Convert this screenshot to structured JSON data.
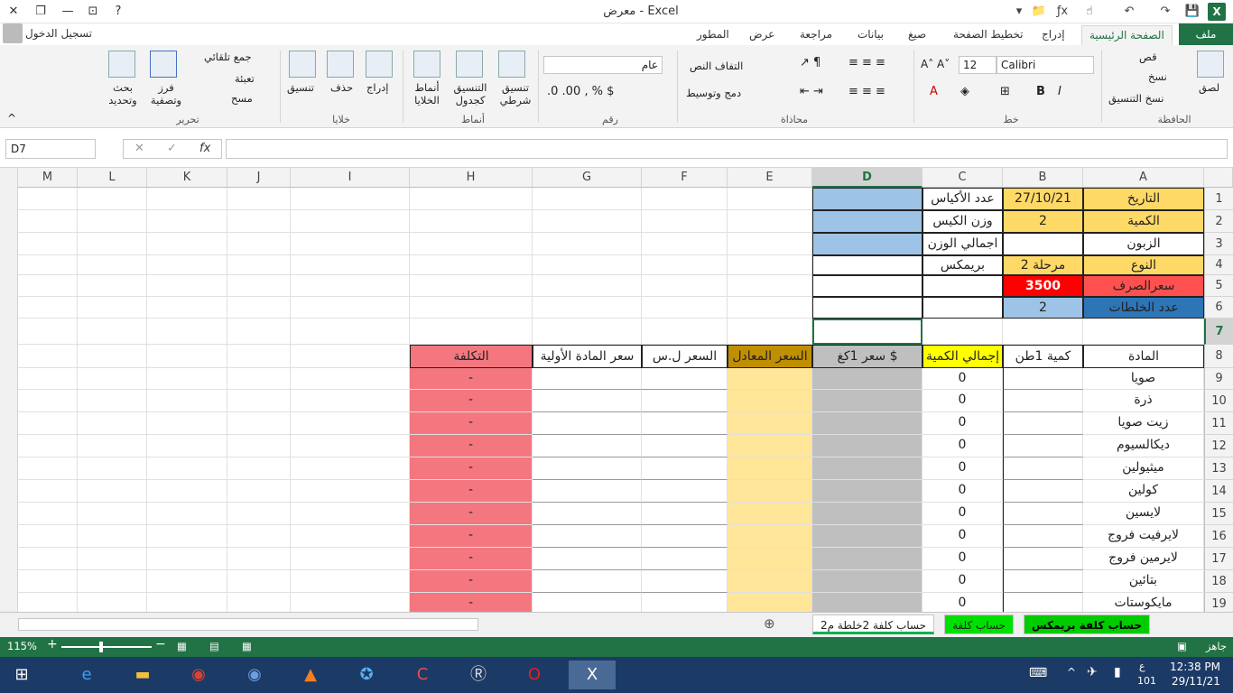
{
  "title": "معرض - Excel",
  "signin": "تسجيل الدخول",
  "tabs": {
    "file": "ملف",
    "home": "الصفحة الرئيسية",
    "insert": "إدراج",
    "page_layout": "تخطيط الصفحة",
    "formulas": "صيغ",
    "data": "بيانات",
    "review": "مراجعة",
    "view": "عرض",
    "developer": "المطور"
  },
  "ribbon": {
    "clipboard": {
      "label": "الحافظة",
      "paste": "لصق",
      "cut": "قص",
      "copy": "نسخ",
      "format_painter": "نسخ التنسيق"
    },
    "font": {
      "label": "خط",
      "name": "Calibri",
      "size": "12"
    },
    "alignment": {
      "label": "محاذاة",
      "wrap": "التفاف النص",
      "merge": "دمج وتوسيط"
    },
    "number": {
      "label": "رقم",
      "format": "عام"
    },
    "styles": {
      "label": "أنماط",
      "conditional": "تنسيق شرطي",
      "as_table": "التنسيق كجدول",
      "cell_styles": "أنماط الخلايا"
    },
    "cells": {
      "label": "خلايا",
      "insert": "إدراج",
      "delete": "حذف",
      "format": "تنسيق"
    },
    "editing": {
      "label": "تحرير",
      "autosum": "جمع تلقائي",
      "fill": "تعبئة",
      "clear": "مسح",
      "sort": "فرز وتصفية",
      "find": "بحث وتحديد"
    }
  },
  "namebox": "D7",
  "fx": "fx",
  "columns": [
    "A",
    "B",
    "C",
    "D",
    "E",
    "F",
    "G",
    "H",
    "I",
    "J",
    "K",
    "L",
    "M"
  ],
  "rows": [
    "1",
    "2",
    "3",
    "4",
    "5",
    "6",
    "7",
    "8",
    "9",
    "10",
    "11",
    "12",
    "13",
    "14",
    "15",
    "16",
    "17",
    "18",
    "19"
  ],
  "cells": {
    "A1": "التاريخ",
    "B1": "27/10/21",
    "C1": "عدد الأكياس",
    "A2": "الكمية",
    "B2": "2",
    "C2": "وزن الكيس",
    "A3": "الزبون",
    "C3": "اجمالي الوزن",
    "A4": "النوع",
    "B4": "مرحلة 2",
    "C4": "بريمكس",
    "A5": "سعرالصرف",
    "B5": "3500",
    "A6": "عدد الخلطات",
    "B6": "2",
    "A8": "المادة",
    "B8": "كمية 1طن",
    "C8": "إجمالي الكمية",
    "D8": "سعر 1كغ $",
    "E8": "السعر المعادل",
    "F8": "السعر ل.س",
    "G8": "سعر المادة الأولية",
    "H8": "التكلفة"
  },
  "materials": [
    "صويا",
    "ذرة",
    "زيت صويا",
    "ديكالسيوم",
    "ميثيولين",
    "كولين",
    "لايسين",
    "لايرفيت فروج",
    "لايرمين فروج",
    "بتائين",
    "مايكوستات"
  ],
  "total_qty_value": "0",
  "cost_value": "-",
  "sheets": [
    "حساب كلفة بريمكس",
    "حساب كلفة",
    "حساب كلفة 2خلطة م2"
  ],
  "status": {
    "ready": "جاهز",
    "zoom": "115%"
  },
  "clock": {
    "time": "12:38 PM",
    "date": "29/11/21",
    "lang": "ع",
    "kb": "101"
  },
  "colors": {
    "excel_green": "#217346",
    "orange": "#ffd966",
    "blue": "#9dc3e6",
    "red": "#ff0000",
    "darkblue": "#2e75b6",
    "yellow": "#ffff00",
    "gold": "#bf8f00",
    "gray": "#bfbfbf",
    "salmon": "#f4777f",
    "lightorange": "#ffe699"
  }
}
